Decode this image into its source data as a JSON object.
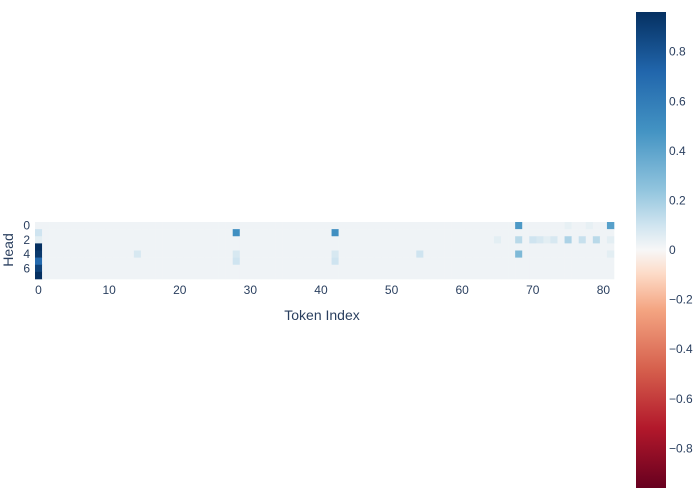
{
  "chart_data": {
    "type": "heatmap",
    "title": "",
    "xlabel": "Token Index",
    "ylabel": "Head",
    "x_tick_labels": [
      "0",
      "10",
      "20",
      "30",
      "40",
      "50",
      "60",
      "70",
      "80"
    ],
    "y_tick_labels": [
      "0",
      "2",
      "4",
      "6"
    ],
    "n_tokens": 82,
    "n_heads": 8,
    "zmin": -0.96,
    "zmax": 0.96,
    "colorscale": "RdBu",
    "colorbar_tick_labels": [
      "0.8",
      "0.6",
      "0.4",
      "0.2",
      "0",
      "−0.2",
      "−0.4",
      "−0.6",
      "−0.8"
    ],
    "colorbar_tick_values": [
      0.8,
      0.6,
      0.4,
      0.2,
      0,
      -0.2,
      -0.4,
      -0.6,
      -0.8
    ],
    "default_value": 0.02,
    "cells": [
      {
        "head": 0,
        "token": 68,
        "value": 0.45
      },
      {
        "head": 0,
        "token": 81,
        "value": 0.42
      },
      {
        "head": 0,
        "token": 75,
        "value": 0.04
      },
      {
        "head": 0,
        "token": 78,
        "value": 0.04
      },
      {
        "head": 1,
        "token": 0,
        "value": 0.1
      },
      {
        "head": 1,
        "token": 28,
        "value": 0.5
      },
      {
        "head": 1,
        "token": 42,
        "value": 0.5
      },
      {
        "head": 2,
        "token": 0,
        "value": 0.05
      },
      {
        "head": 2,
        "token": 65,
        "value": 0.05
      },
      {
        "head": 2,
        "token": 68,
        "value": 0.15
      },
      {
        "head": 2,
        "token": 70,
        "value": 0.1
      },
      {
        "head": 2,
        "token": 71,
        "value": 0.08
      },
      {
        "head": 2,
        "token": 72,
        "value": 0.05
      },
      {
        "head": 2,
        "token": 73,
        "value": 0.08
      },
      {
        "head": 2,
        "token": 75,
        "value": 0.18
      },
      {
        "head": 2,
        "token": 77,
        "value": 0.12
      },
      {
        "head": 2,
        "token": 79,
        "value": 0.15
      },
      {
        "head": 2,
        "token": 81,
        "value": 0.05
      },
      {
        "head": 3,
        "token": 0,
        "value": 0.96
      },
      {
        "head": 4,
        "token": 0,
        "value": 0.92
      },
      {
        "head": 4,
        "token": 14,
        "value": 0.08
      },
      {
        "head": 4,
        "token": 28,
        "value": 0.08
      },
      {
        "head": 4,
        "token": 42,
        "value": 0.08
      },
      {
        "head": 4,
        "token": 54,
        "value": 0.1
      },
      {
        "head": 4,
        "token": 68,
        "value": 0.3
      },
      {
        "head": 4,
        "token": 81,
        "value": 0.05
      },
      {
        "head": 5,
        "token": 0,
        "value": 0.7
      },
      {
        "head": 5,
        "token": 28,
        "value": 0.1
      },
      {
        "head": 5,
        "token": 42,
        "value": 0.1
      },
      {
        "head": 6,
        "token": 0,
        "value": 0.88
      },
      {
        "head": 7,
        "token": 0,
        "value": 0.96
      }
    ]
  }
}
